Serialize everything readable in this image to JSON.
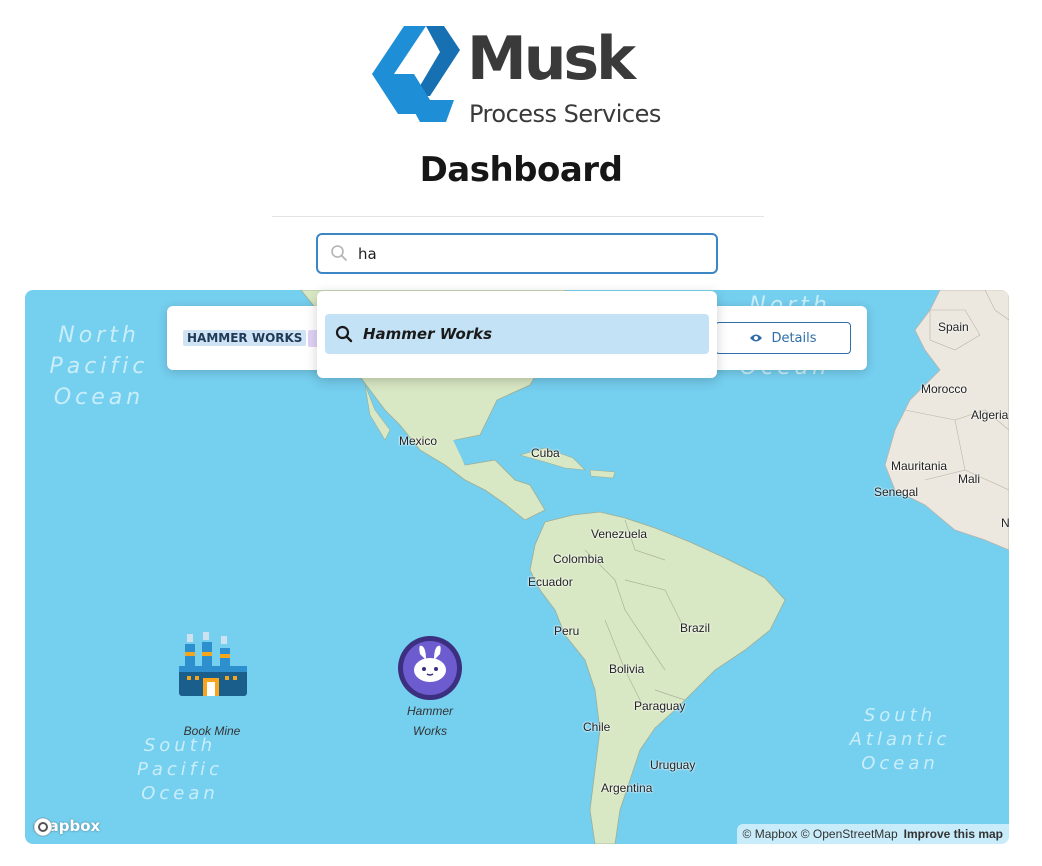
{
  "brand": {
    "name": "Musk",
    "tagline": "Process Services",
    "colors": {
      "logo_blue": "#1e8fd6",
      "logo_blue_dark": "#1670b2",
      "text": "#3a3a3a"
    }
  },
  "page_title": "Dashboard",
  "search": {
    "value": "ha",
    "placeholder": ""
  },
  "card": {
    "tag": "HAMMER WORKS",
    "details_label": "Details"
  },
  "dropdown": {
    "items": [
      {
        "label": "Hammer Works",
        "icon": "search-icon"
      }
    ]
  },
  "map": {
    "oceans": [
      {
        "label": "North\nPacific\nOcean"
      },
      {
        "label": "North"
      },
      {
        "label": "Ocean"
      },
      {
        "label": "South\nPacific\nOcean"
      },
      {
        "label": "South\nAtlantic\nOcean"
      }
    ],
    "countries": [
      "Spain",
      "Morocco",
      "Algeria",
      "Mexico",
      "Cuba",
      "Mauritania",
      "Mali",
      "Senegal",
      "N",
      "Venezuela",
      "Colombia",
      "Ecuador",
      "Peru",
      "Brazil",
      "Bolivia",
      "Paraguay",
      "Chile",
      "Uruguay",
      "Argentina"
    ],
    "markers": [
      {
        "label": "Book Mine",
        "icon": "factory-icon"
      },
      {
        "label": "Hammer\nWorks",
        "icon": "bunny-icon"
      }
    ],
    "logo": "mapbox",
    "attribution": {
      "text": "© Mapbox © OpenStreetMap",
      "link": "Improve this map"
    },
    "colors": {
      "water": "#75cfef",
      "land": "#d9e8c4",
      "land_africa": "#ece8e0"
    }
  }
}
